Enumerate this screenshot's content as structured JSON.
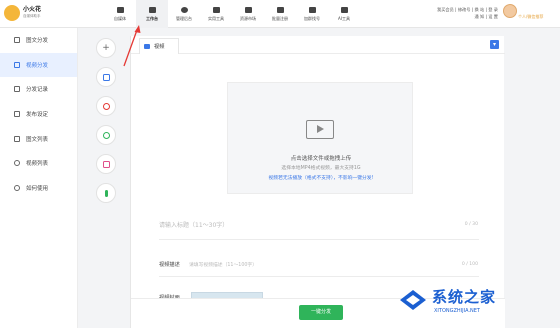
{
  "app": {
    "name": "小火花",
    "subtitle": "自媒体助手"
  },
  "nav": [
    {
      "label": "自媒体",
      "icon": "home-icon"
    },
    {
      "label": "工作台",
      "icon": "monitor-icon",
      "active": true
    },
    {
      "label": "管理后台",
      "icon": "pie-chart-icon"
    },
    {
      "label": "实用工具",
      "icon": "grid-icon"
    },
    {
      "label": "资源市场",
      "icon": "store-icon"
    },
    {
      "label": "批量注册",
      "icon": "user-plus-icon"
    },
    {
      "label": "加群找号",
      "icon": "plus-square-icon"
    },
    {
      "label": "AI工具",
      "icon": "ai-icon"
    }
  ],
  "top_links": {
    "line1": "我买会员 | 修改号 | 换 站 | 登 录",
    "line2": "通 知 | 设 置"
  },
  "user_tag": "个人/微信推荐",
  "sidebar": {
    "items": [
      {
        "label": "图文分发",
        "icon": "doc-icon"
      },
      {
        "label": "视频分发",
        "icon": "video-icon",
        "active": true
      },
      {
        "label": "分发记录",
        "icon": "record-icon"
      },
      {
        "label": "发布设定",
        "icon": "send-icon"
      },
      {
        "label": "图文列表",
        "icon": "list-icon"
      },
      {
        "label": "视频列表",
        "icon": "play-list-icon"
      },
      {
        "label": "如何使用",
        "icon": "help-icon"
      }
    ]
  },
  "tools": [
    "add-icon",
    "calendar-icon",
    "timer-icon",
    "refresh-icon",
    "image-icon",
    "audio-icon"
  ],
  "tab": {
    "label": "视频"
  },
  "upload": {
    "main": "点击选择文件或拖拽上传",
    "sub": "选择本地MP4格式视频，最大支持1G",
    "link": "视频若无法播放（格式不支持），不影响一键分发!"
  },
  "title_field": {
    "placeholder": "请输入标题（11～30字）",
    "count": "0 / 30"
  },
  "desc_field": {
    "label": "视频描述",
    "placeholder": "请填写视频描述（11～100字）",
    "count": "0 / 100"
  },
  "cover_field": {
    "label": "视频封面"
  },
  "publish_label": "一键分发",
  "watermark": {
    "text": "系统之家",
    "url": "XITONGZHIJIA.NET"
  },
  "colors": {
    "accent": "#3b78e7",
    "publish": "#2fb45a",
    "annotation": "#e53935"
  }
}
